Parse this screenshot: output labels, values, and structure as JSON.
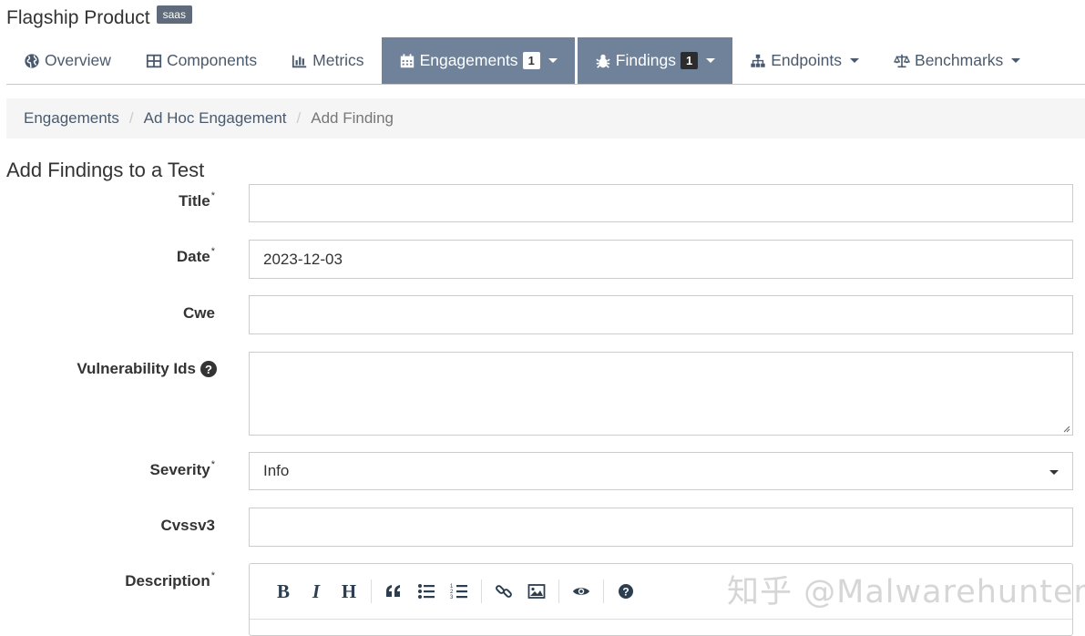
{
  "header": {
    "title": "Flagship Product",
    "badge": "saas"
  },
  "nav": {
    "tabs": [
      {
        "label": "Overview",
        "icon": "globe-icon"
      },
      {
        "label": "Components",
        "icon": "table-icon"
      },
      {
        "label": "Metrics",
        "icon": "bar-chart-icon"
      },
      {
        "label": "Engagements",
        "icon": "calendar-icon",
        "count": "1",
        "active": true
      },
      {
        "label": "Findings",
        "icon": "bug-icon",
        "count": "1",
        "active": true
      },
      {
        "label": "Endpoints",
        "icon": "sitemap-icon"
      },
      {
        "label": "Benchmarks",
        "icon": "balance-scale-icon"
      }
    ],
    "active_color": "#6f8299"
  },
  "breadcrumb": {
    "items": [
      "Engagements",
      "Ad Hoc Engagement",
      "Add Finding"
    ]
  },
  "page": {
    "title": "Add Findings to a Test"
  },
  "form": {
    "title": {
      "label": "Title",
      "required": "*",
      "value": ""
    },
    "date": {
      "label": "Date",
      "required": "*",
      "value": "2023-12-03"
    },
    "cwe": {
      "label": "Cwe",
      "value": ""
    },
    "vulnerability_ids": {
      "label": "Vulnerability Ids",
      "help": "?",
      "value": ""
    },
    "severity": {
      "label": "Severity",
      "required": "*",
      "value": "Info"
    },
    "cvssv3": {
      "label": "Cvssv3",
      "value": ""
    },
    "description": {
      "label": "Description",
      "required": "*"
    }
  },
  "editor_toolbar": {
    "bold": "B",
    "italic": "I",
    "heading": "H",
    "icons": [
      "quote-icon",
      "unordered-list-icon",
      "ordered-list-icon",
      "link-icon",
      "image-icon",
      "preview-eye-icon",
      "help-circle-icon"
    ]
  },
  "watermark": "知乎 @Malwarehunter"
}
